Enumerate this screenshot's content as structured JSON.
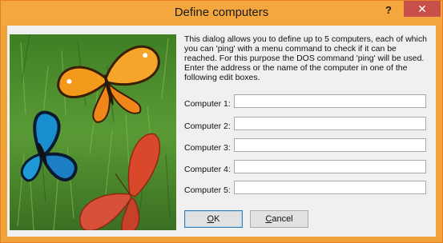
{
  "window": {
    "title": "Define computers",
    "help_glyph": "?",
    "close_glyph": "✕"
  },
  "description": "This dialog allows you to define up to 5 computers, each of which you can 'ping' with a menu command to check if it can be reached. For this purpose the DOS command 'ping' will be used. Enter the address or the name of the computer in one of the following edit boxes.",
  "computers": [
    {
      "label": "Computer 1:",
      "value": ""
    },
    {
      "label": "Computer 2:",
      "value": ""
    },
    {
      "label": "Computer 3:",
      "value": ""
    },
    {
      "label": "Computer 4:",
      "value": ""
    },
    {
      "label": "Computer 5:",
      "value": ""
    }
  ],
  "buttons": {
    "ok_mnemonic": "O",
    "ok_rest": "K",
    "cancel_mnemonic": "C",
    "cancel_rest": "ancel"
  },
  "colors": {
    "title_bar": "#f3a73e",
    "close_button": "#c7504a"
  },
  "picture": "butterflies-on-grass"
}
